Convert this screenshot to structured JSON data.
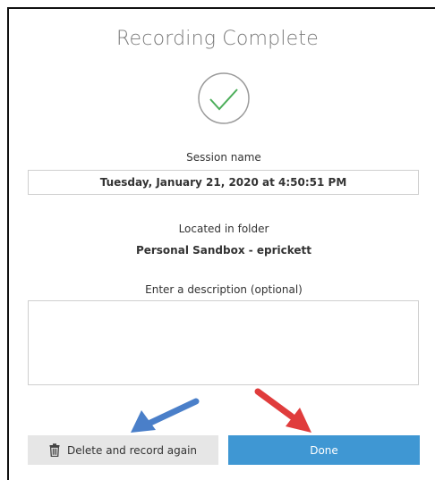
{
  "dialog": {
    "title": "Recording Complete",
    "check_icon": "checkmark-circle-icon",
    "session": {
      "label": "Session name",
      "value": "Tuesday, January 21, 2020 at 4:50:51 PM"
    },
    "folder": {
      "label": "Located in folder",
      "value": "Personal Sandbox - eprickett"
    },
    "description": {
      "label": "Enter a description (optional)",
      "value": ""
    },
    "buttons": {
      "delete_label": "Delete and record again",
      "delete_icon": "trash-icon",
      "done_label": "Done"
    }
  },
  "colors": {
    "title": "#7a7a7a",
    "check": "#4cae5a",
    "done_button": "#3f97d3",
    "delete_button": "#e6e6e6",
    "annotation_blue_arrow": "#4a7fc9",
    "annotation_red_arrow": "#e03c3c"
  }
}
